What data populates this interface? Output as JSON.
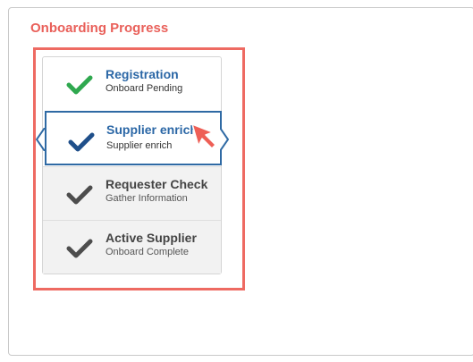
{
  "panel": {
    "title": "Onboarding Progress"
  },
  "steps": [
    {
      "title": "Registration",
      "subtitle": "Onboard Pending",
      "status": "complete",
      "check_color": "#2fa84f",
      "title_color": "#2b67a6"
    },
    {
      "title": "Supplier enrich",
      "subtitle": "Supplier enrich",
      "status": "current",
      "check_color": "#1f4f8a",
      "title_color": "#2b67a6"
    },
    {
      "title": "Requester Check",
      "subtitle": "Gather Information",
      "status": "pending",
      "check_color": "#4d4d4d",
      "title_color": "#444444"
    },
    {
      "title": "Active Supplier",
      "subtitle": "Onboard Complete",
      "status": "pending",
      "check_color": "#4d4d4d",
      "title_color": "#444444"
    }
  ],
  "colors": {
    "highlight": "#ee6a62",
    "active_border": "#2f6aa4",
    "title_accent": "#e9605a"
  },
  "icons": {
    "check": "checkmark-icon",
    "cursor": "pointer-arrow-icon"
  }
}
